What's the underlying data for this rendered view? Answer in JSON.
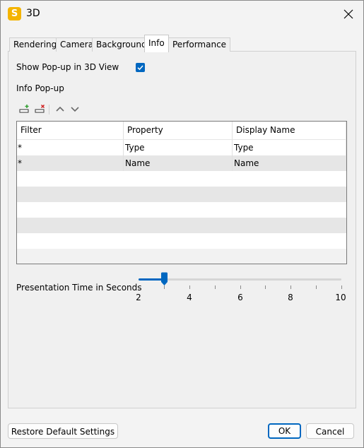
{
  "window": {
    "title": "3D",
    "app_icon_letter": "S"
  },
  "tabs": [
    {
      "label": "Rendering"
    },
    {
      "label": "Camera"
    },
    {
      "label": "Background"
    },
    {
      "label": "Info",
      "active": true
    },
    {
      "label": "Performance"
    }
  ],
  "info": {
    "show_popup_label": "Show Pop-up in 3D View",
    "show_popup_checked": true,
    "info_popup_label": "Info Pop-up",
    "table": {
      "columns": [
        "Filter",
        "Property",
        "Display Name"
      ],
      "rows": [
        {
          "filter": "*",
          "property": "Type",
          "display_name": "Type"
        },
        {
          "filter": "*",
          "property": "Name",
          "display_name": "Name"
        }
      ]
    },
    "presentation": {
      "label": "Presentation Time in Seconds",
      "min": 2,
      "max": 10,
      "value": 3,
      "tick_labels": [
        "2",
        "4",
        "6",
        "8",
        "10"
      ]
    }
  },
  "footer": {
    "restore_label": "Restore Default Settings",
    "ok_label": "OK",
    "cancel_label": "Cancel"
  },
  "colors": {
    "accent": "#0067c0",
    "app_icon": "#f4b400"
  },
  "icons": [
    "app-icon",
    "close-icon",
    "add-row-icon",
    "delete-row-icon",
    "move-up-icon",
    "move-down-icon",
    "checkmark-icon"
  ]
}
